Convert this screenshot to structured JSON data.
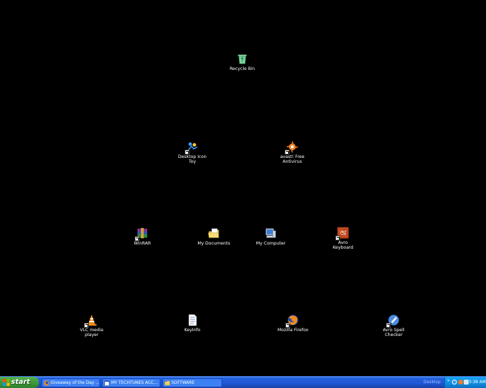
{
  "desktop": {
    "icons": {
      "recycle_bin": "Recycle Bin",
      "desktop_icon_toy_l1": "Desktop Icon",
      "desktop_icon_toy_l2": "Toy",
      "avast_l1": "avast! Free",
      "avast_l2": "Antivirus",
      "winrar": "WinRAR",
      "my_documents": "My Documents",
      "my_computer": "My Computer",
      "avro_keyboard_l1": "Avro",
      "avro_keyboard_l2": "Keyboard",
      "vlc_l1": "VLC media",
      "vlc_l2": "player",
      "keyinfo": "KeyInfo",
      "firefox": "Mozilla Firefox",
      "avro_spell_l1": "Avro Spell",
      "avro_spell_l2": "Checker"
    }
  },
  "taskbar": {
    "start_label": "start",
    "tasks": [
      "Giveaway of the Day ...",
      "MY TECHTUNES ACC...",
      "SOFTWARE"
    ],
    "desktop_toolbar_label": "Desktop",
    "tray_chevron": "»",
    "clock": "3:38 AM"
  },
  "colors": {
    "desktop_background": "#000000",
    "taskbar": "#245edb",
    "start_button": "#3c9a3a",
    "tray": "#0f8ce0"
  }
}
